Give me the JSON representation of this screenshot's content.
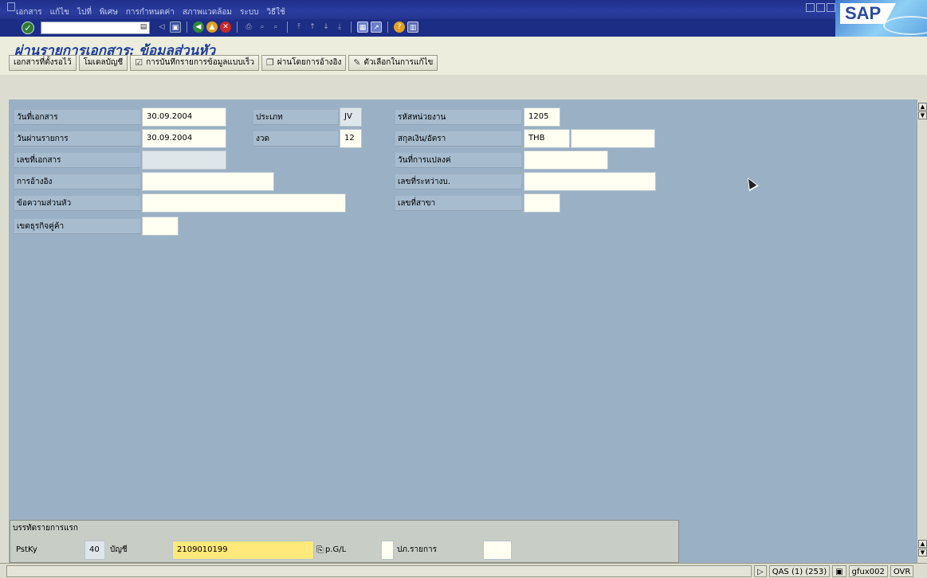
{
  "menu": [
    "เอกสาร",
    "แก้ไข",
    "ไปที่",
    "พิเศษ",
    "การกำหนดค่า",
    "สภาพแวดล้อม",
    "ระบบ",
    "วิธีใช้"
  ],
  "brand": "SAP",
  "command_field": {
    "value": ""
  },
  "toolbar_icons": [
    "save-icon",
    "back-icon",
    "exit-icon",
    "cancel-icon",
    "print-icon",
    "find-icon",
    "find-next-icon",
    "first-page-icon",
    "prev-page-icon",
    "next-page-icon",
    "last-page-icon",
    "new-session-icon",
    "shortcut-icon",
    "help-icon",
    "layout-icon"
  ],
  "screen_title": "ผ่านรายการเอกสาร: ข้อมูลส่วนหัว",
  "app_toolbar": {
    "parked": "เอกสารที่ตั้งรอไว้",
    "acct_model": "โมเดลบัญชี",
    "fast_entry": "การบันทึกรายการข้อมูลแบบเร็ว",
    "post_ref": "ผ่านโดยการอ้างอิง",
    "edit_opts": "ตัวเลือกในการแก้ไข"
  },
  "header": {
    "doc_date_label": "วันที่เอกสาร",
    "doc_date": "30.09.2004",
    "post_date_label": "วันผ่านรายการ",
    "post_date": "30.09.2004",
    "doc_no_label": "เลขที่เอกสาร",
    "doc_no": "",
    "ref_label": "การอ้างอิง",
    "ref": "",
    "header_text_label": "ข้อความส่วนหัว",
    "header_text": "",
    "trading_partner_label": "เขตธุรกิจคู่ค้า",
    "trading_partner": "",
    "type_label": "ประเภท",
    "type": "JV",
    "period_label": "งวด",
    "period": "12",
    "company_code_label": "รหัสหน่วยงาน",
    "company_code": "1205",
    "currency_label": "สกุลเงิน/อัตรา",
    "currency": "THB",
    "rate": "",
    "translation_date_label": "วันที่การแปลงค่",
    "translation_date": "",
    "cross_cc_label": "เลขที่ระหว่างบ.",
    "cross_cc": "",
    "branch_label": "เลขที่สาขา",
    "branch": ""
  },
  "first_line": {
    "group_title": "บรรทัดรายการแรก",
    "pstky_label": "PstKy",
    "pstky": "40",
    "account_label": "บัญชี",
    "account": "2109010199",
    "gl_label": "p.G/L",
    "tx_type_label": "ปภ.รายการ",
    "tx_type": ""
  },
  "status": {
    "system": "QAS (1) (253)",
    "user": "gfux002",
    "mode": "OVR"
  },
  "colors": {
    "accent": "#1d3c9c",
    "workarea": "#9ab0c4",
    "input": "#fffff2",
    "highlight": "#ffe97a"
  }
}
